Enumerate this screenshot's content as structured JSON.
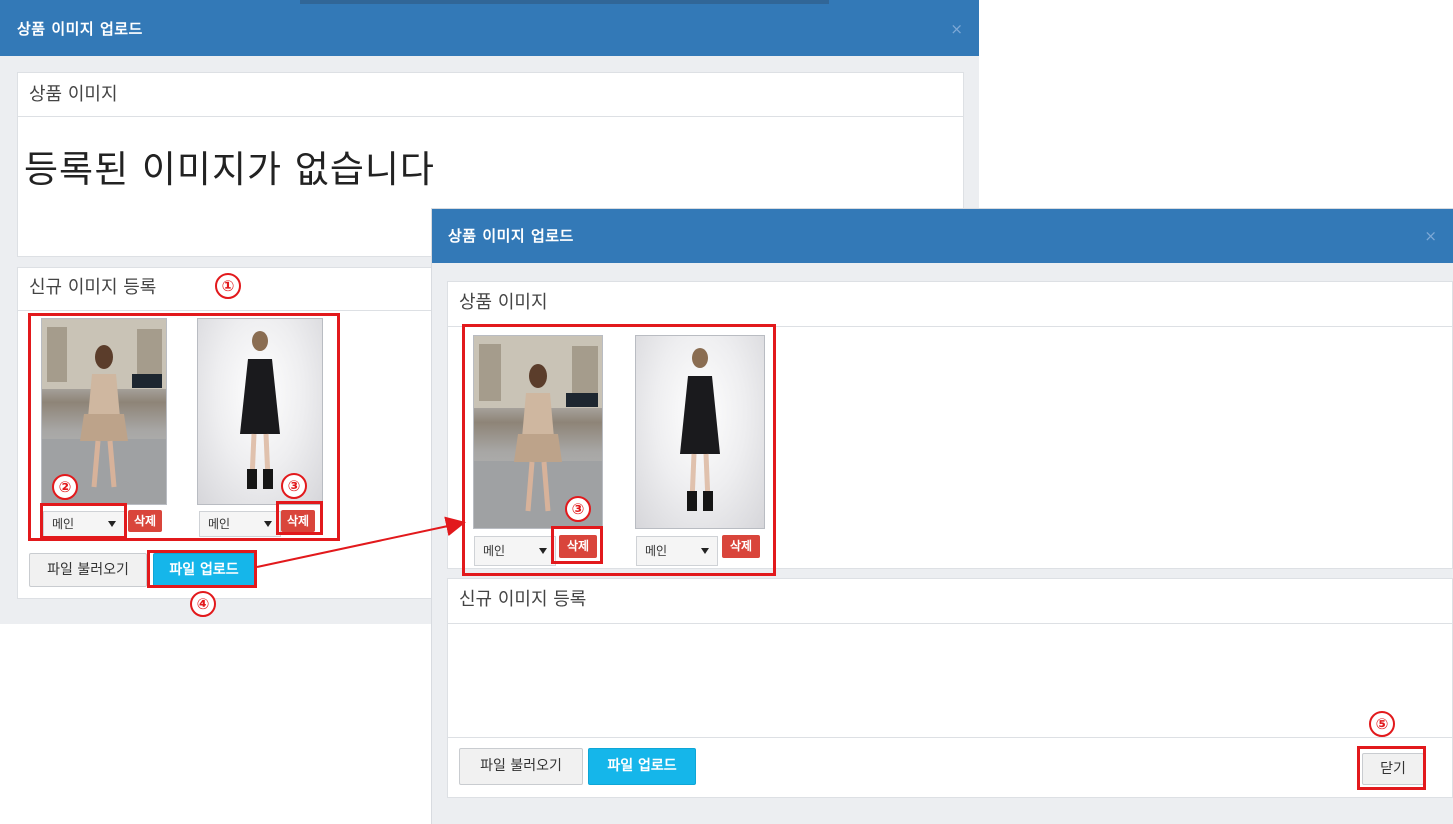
{
  "modal_left": {
    "title": "상품 이미지 업로드",
    "close": "×",
    "product_panel": {
      "heading": "상품 이미지",
      "empty_message": "등록된 이미지가 없습니다"
    },
    "new_panel": {
      "heading": "신규 이미지 등록",
      "images": [
        {
          "select_value": "메인",
          "delete_label": "삭제"
        },
        {
          "select_value": "메인",
          "delete_label": "삭제"
        }
      ],
      "load_button": "파일 불러오기",
      "upload_button": "파일 업로드"
    }
  },
  "modal_right": {
    "title": "상품 이미지 업로드",
    "close": "×",
    "product_panel": {
      "heading": "상품 이미지",
      "images": [
        {
          "select_value": "메인",
          "delete_label": "삭제"
        },
        {
          "select_value": "메인",
          "delete_label": "삭제"
        }
      ]
    },
    "new_panel": {
      "heading": "신규 이미지 등록",
      "load_button": "파일 불러오기",
      "upload_button": "파일 업로드",
      "close_button": "닫기"
    }
  },
  "annotations": {
    "step1": "①",
    "step2": "②",
    "step3a": "③",
    "step3b": "③",
    "step4": "④",
    "step5": "⑤"
  },
  "colors": {
    "header": "#3379b7",
    "primary": "#15b6ea",
    "danger": "#d9453b",
    "highlight": "#e2191c"
  }
}
